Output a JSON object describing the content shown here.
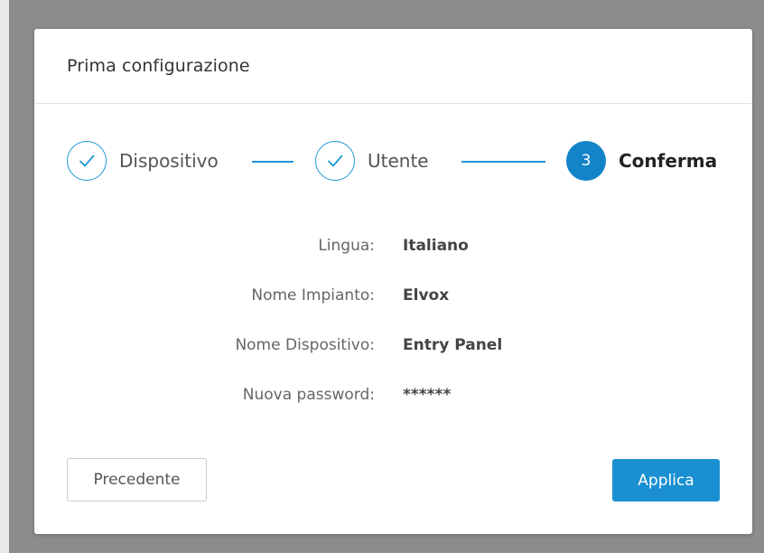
{
  "dialog": {
    "title": "Prima configurazione"
  },
  "stepper": {
    "steps": [
      {
        "label": "Dispositivo",
        "state": "done"
      },
      {
        "label": "Utente",
        "state": "done"
      },
      {
        "label": "Conferma",
        "state": "active",
        "number": "3"
      }
    ]
  },
  "summary": {
    "rows": [
      {
        "key": "Lingua:",
        "value": "Italiano"
      },
      {
        "key": "Nome Impianto:",
        "value": "Elvox"
      },
      {
        "key": "Nome Dispositivo:",
        "value": "Entry Panel"
      },
      {
        "key": "Nuova password:",
        "value": "******"
      }
    ]
  },
  "buttons": {
    "previous_label": "Precedente",
    "apply_label": "Applica"
  },
  "colors": {
    "accent": "#1e98d7",
    "primary_button": "#1a8fd1",
    "active_step": "#1484c8",
    "backdrop": "#8c8c8c"
  }
}
